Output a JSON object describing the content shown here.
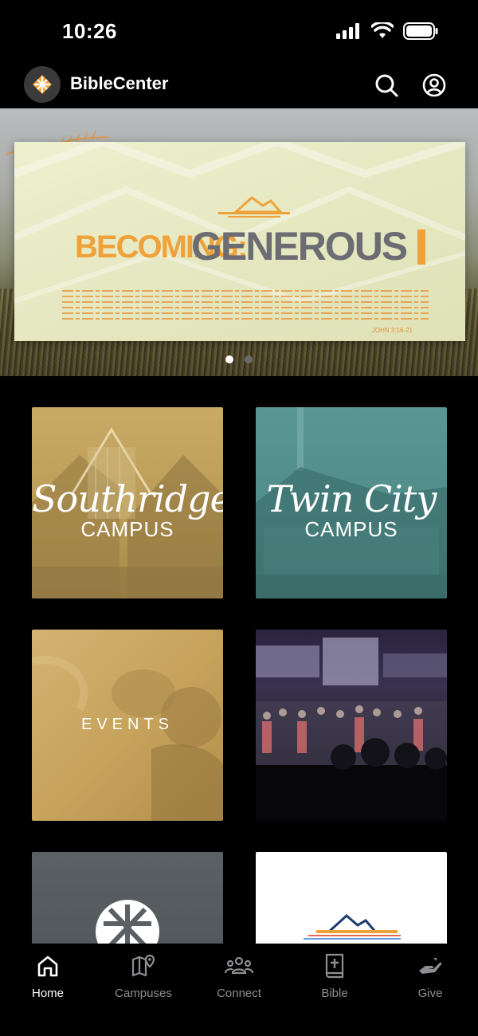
{
  "status_bar": {
    "time": "10:26"
  },
  "header": {
    "app_title": "BibleCenter"
  },
  "hero": {
    "title_left": "BECOMING:",
    "title_right": "GENEROUS",
    "verse_ref": "JOHN 3:16-21",
    "page_count": 2,
    "active_page": 1
  },
  "tiles": [
    {
      "script": "Southridge",
      "caps": "CAMPUS"
    },
    {
      "script": "Twin City",
      "caps": "CAMPUS"
    },
    {
      "caps": "EVENTS"
    },
    {},
    {},
    {}
  ],
  "nav": [
    {
      "label": "Home",
      "icon": "home-icon",
      "active": true
    },
    {
      "label": "Campuses",
      "icon": "map-pin-icon",
      "active": false
    },
    {
      "label": "Connect",
      "icon": "people-icon",
      "active": false
    },
    {
      "label": "Bible",
      "icon": "bible-icon",
      "active": false
    },
    {
      "label": "Give",
      "icon": "hand-icon",
      "active": false
    }
  ],
  "colors": {
    "accent_orange": "#f0a23a",
    "southridge_tint": "#b89a55",
    "twincity_tint": "#4f8c89",
    "events_tint": "#c7a35c",
    "nav_inactive": "#8e8e93"
  }
}
